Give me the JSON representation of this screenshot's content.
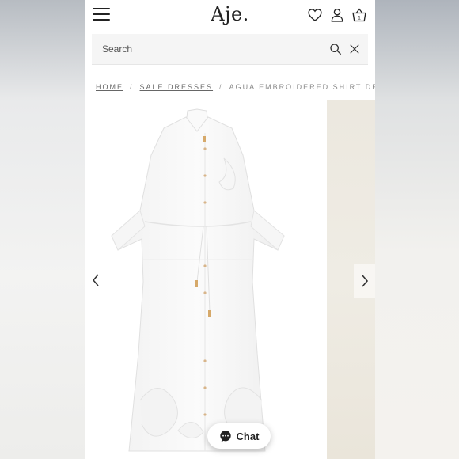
{
  "header": {
    "logo": "Aje.",
    "icons": [
      "menu-icon",
      "heart-icon",
      "user-icon",
      "basket-icon"
    ],
    "cart_count": "1"
  },
  "search": {
    "placeholder": "Search",
    "icons": [
      "search-icon",
      "close-icon"
    ]
  },
  "breadcrumb": {
    "home": "HOME",
    "category": "SALE DRESSES",
    "current": "AGUA EMBROIDERED SHIRT DRESS",
    "separator": "/"
  },
  "gallery": {
    "nav_icons": [
      "chevron-left-icon",
      "chevron-right-icon"
    ]
  },
  "chat": {
    "label": "Chat",
    "icon": "chat-bubble-icon"
  },
  "colors": {
    "text": "#222222",
    "search_bg": "#f5f5f5",
    "next_image_bg": "#ece8df"
  }
}
